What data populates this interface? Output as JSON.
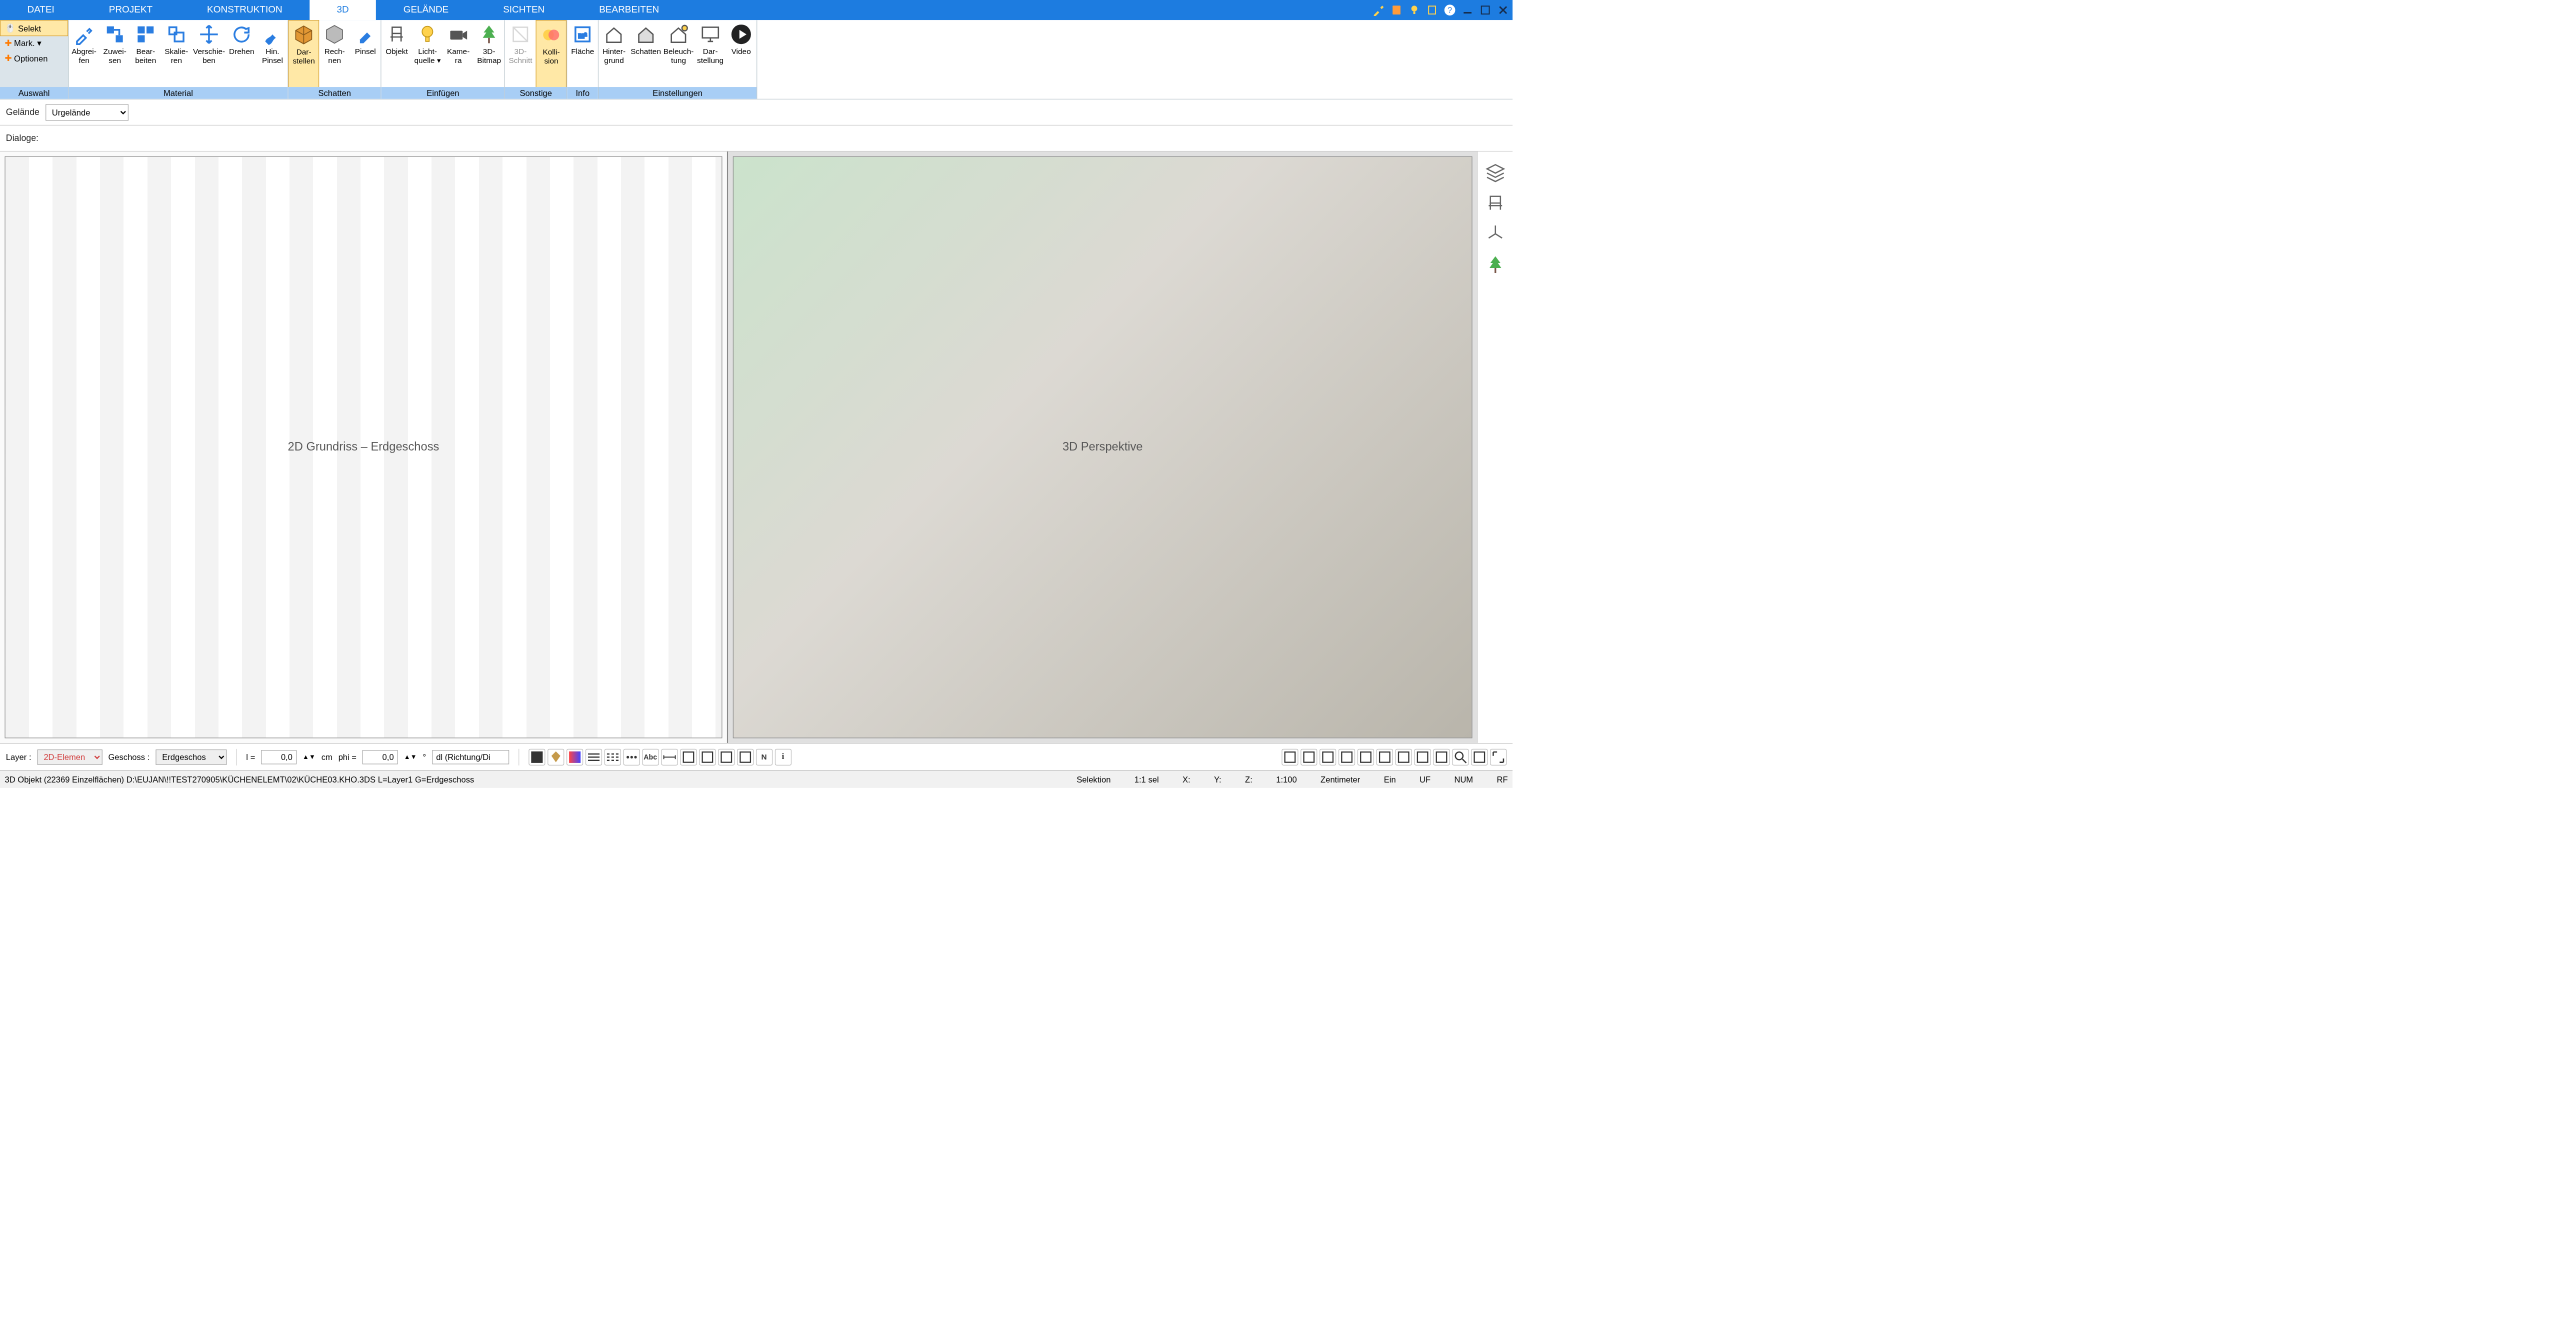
{
  "menu": {
    "tabs": [
      "DATEI",
      "PROJEKT",
      "KONSTRUKTION",
      "3D",
      "GELÄNDE",
      "SICHTEN",
      "BEARBEITEN"
    ],
    "active_index": 3,
    "sys_icons": [
      "wrench-icon",
      "book-icon",
      "lamp-icon",
      "clip-icon",
      "help-icon",
      "minimize-icon",
      "maximize-icon",
      "close-icon"
    ]
  },
  "ribbon_left": {
    "items": [
      {
        "label": "Selekt",
        "icon": "cursor-icon",
        "selected": true
      },
      {
        "label": "Mark. ▾",
        "icon": "plus-icon"
      },
      {
        "label": "Optionen",
        "icon": "plus-icon-orange"
      }
    ],
    "group_label": "Auswahl"
  },
  "ribbon_groups": [
    {
      "label": "Material",
      "buttons": [
        {
          "label": "Abgrei-\nfen",
          "icon": "eyedropper-icon"
        },
        {
          "label": "Zuwei-\nsen",
          "icon": "assign-icon"
        },
        {
          "label": "Bear-\nbeiten",
          "icon": "edit-icon"
        },
        {
          "label": "Skalie-\nren",
          "icon": "scale-icon"
        },
        {
          "label": "Verschie-\nben",
          "icon": "move-icon"
        },
        {
          "label": "Drehen",
          "icon": "rotate-icon"
        },
        {
          "label": "Hin.\nPinsel",
          "icon": "brush-icon"
        }
      ]
    },
    {
      "label": "Schatten",
      "buttons": [
        {
          "label": "Dar-\nstellen",
          "icon": "cube-icon",
          "active": true
        },
        {
          "label": "Rech-\nnen",
          "icon": "cube-calc-icon"
        },
        {
          "label": "Pinsel",
          "icon": "brush2-icon"
        }
      ]
    },
    {
      "label": "Einfügen",
      "buttons": [
        {
          "label": "Objekt",
          "icon": "chair-icon"
        },
        {
          "label": "Licht-\nquelle ▾",
          "icon": "bulb-icon"
        },
        {
          "label": "Kame-\nra",
          "icon": "camera-icon"
        },
        {
          "label": "3D-\nBitmap",
          "icon": "tree-icon"
        }
      ]
    },
    {
      "label": "Sonstige",
      "buttons": [
        {
          "label": "3D-\nSchnitt",
          "icon": "section-icon",
          "disabled": true
        },
        {
          "label": "Kolli-\nsion",
          "icon": "collision-icon",
          "active": true
        }
      ]
    },
    {
      "label": "Info",
      "buttons": [
        {
          "label": "Fläche",
          "icon": "area-icon"
        }
      ]
    },
    {
      "label": "Einstellungen",
      "buttons": [
        {
          "label": "Hinter-\ngrund",
          "icon": "house-bg-icon"
        },
        {
          "label": "Schatten",
          "icon": "house-shadow-icon"
        },
        {
          "label": "Beleuch-\ntung",
          "icon": "house-light-icon"
        },
        {
          "label": "Dar-\nstellung",
          "icon": "screen-icon"
        },
        {
          "label": "Video",
          "icon": "play-icon"
        }
      ]
    }
  ],
  "bar_terrain": {
    "label": "Gelände",
    "value": "Urgelände"
  },
  "bar_dialog": {
    "label": "Dialoge:"
  },
  "viewports": {
    "left_placeholder": "2D Grundriss – Erdgeschoss",
    "right_placeholder": "3D Perspektive"
  },
  "side_panel_icons": [
    "layers-icon",
    "chair-side-icon",
    "axes-icon",
    "tree-side-icon"
  ],
  "bottom": {
    "layer_label": "Layer :",
    "layer_value": "2D-Elemen",
    "floor_label": "Geschoss :",
    "floor_value": "Erdgeschos",
    "l_label": "l =",
    "l_value": "0,0",
    "unit_cm": "cm",
    "phi_label": "phi =",
    "phi_value": "0,0",
    "deg": "°",
    "dl_value": "dl (Richtung/Di",
    "left_icons": [
      "fill-icon",
      "bucket-icon",
      "grad-icon",
      "lines-icon",
      "dash-icon",
      "dots-icon",
      "abc-icon",
      "dim-icon",
      "rect1-icon",
      "rect2-icon",
      "rect3-icon",
      "hatch-icon",
      "n-icon",
      "info-icon"
    ],
    "right_icons": [
      "vp-split-icon",
      "vp-single-icon",
      "vp-multi-icon",
      "grid-icon",
      "snap-icon",
      "ortho-icon",
      "extent-icon",
      "zoom-icon",
      "fit-icon",
      "mag-icon",
      "target-icon",
      "expand-icon"
    ]
  },
  "status": {
    "path": "3D Objekt (22369 Einzelflächen) D:\\EUJAN\\!!TEST270905\\KÜCHENELEMT\\02\\KÜCHE03.KHO.3DS L=Layer1 G=Erdgeschoss",
    "selektion": "Selektion",
    "sel": "1:1 sel",
    "x": "X:",
    "y": "Y:",
    "z": "Z:",
    "scale": "1:100",
    "unit": "Zentimeter",
    "ein": "Ein",
    "uf": "UF",
    "num": "NUM",
    "rf": "RF"
  }
}
